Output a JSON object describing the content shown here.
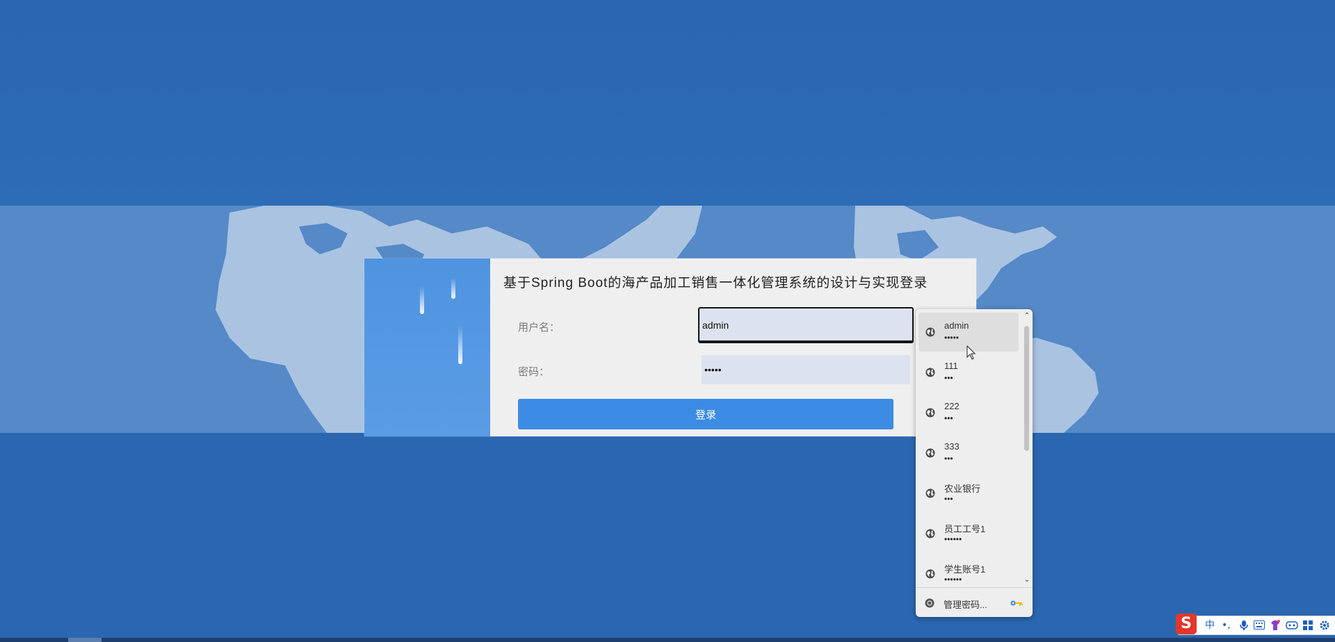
{
  "login": {
    "title": "基于Spring Boot的海产品加工销售一体化管理系统的设计与实现登录",
    "username_label": "用户名：",
    "username_value": "admin",
    "password_label": "密码：",
    "password_value": "•••••",
    "login_button": "登录"
  },
  "autofill": {
    "items": [
      {
        "username": "admin",
        "password": "•••••"
      },
      {
        "username": "111",
        "password": "•••"
      },
      {
        "username": "222",
        "password": "•••"
      },
      {
        "username": "333",
        "password": "•••"
      },
      {
        "username": "农业银行",
        "password": "•••"
      },
      {
        "username": "员工工号1",
        "password": "••••••"
      },
      {
        "username": "学生账号1",
        "password": "••••••"
      }
    ],
    "manage_label": "管理密码..."
  },
  "ime": {
    "logo": "S",
    "mode": "中",
    "punct": "•,"
  },
  "colors": {
    "background": "#2a67b0",
    "map_band": "#5589c7",
    "login_button": "#3d8ce3",
    "input_fill": "#dde3ee"
  }
}
